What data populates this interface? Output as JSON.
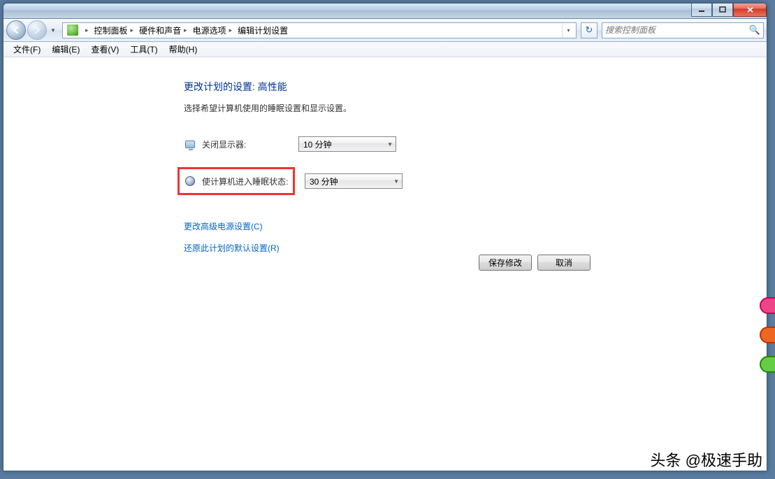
{
  "breadcrumb": {
    "items": [
      "控制面板",
      "硬件和声音",
      "电源选项",
      "编辑计划设置"
    ]
  },
  "search": {
    "placeholder": "搜索控制面板"
  },
  "menubar": {
    "items": [
      "文件(F)",
      "编辑(E)",
      "查看(V)",
      "工具(T)",
      "帮助(H)"
    ]
  },
  "page": {
    "heading": "更改计划的设置: 高性能",
    "subtext": "选择希望计算机使用的睡眠设置和显示设置。",
    "display_off_label": "关闭显示器:",
    "display_off_value": "10 分钟",
    "sleep_label": "使计算机进入睡眠状态:",
    "sleep_value": "30 分钟",
    "link_advanced": "更改高级电源设置(C)",
    "link_restore": "还原此计划的默认设置(R)",
    "btn_save": "保存修改",
    "btn_cancel": "取消"
  },
  "watermark": "头条 @极速手助"
}
